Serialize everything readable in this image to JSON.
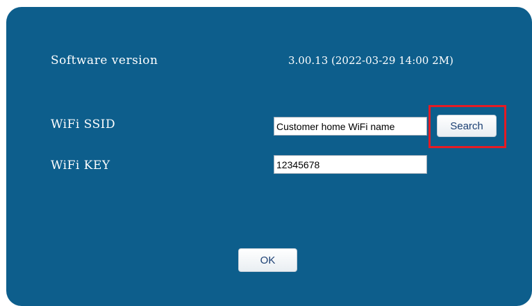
{
  "software_version": {
    "label": "Software version",
    "value": "3.00.13 (2022-03-29 14:00 2M)"
  },
  "wifi_ssid": {
    "label": "WiFi SSID",
    "value": "Customer home WiFi name",
    "search_label": "Search"
  },
  "wifi_key": {
    "label": "WiFi KEY",
    "value": "12345678"
  },
  "ok_label": "OK",
  "colors": {
    "panel": "#0d5e8c",
    "highlight": "#e51b24"
  }
}
